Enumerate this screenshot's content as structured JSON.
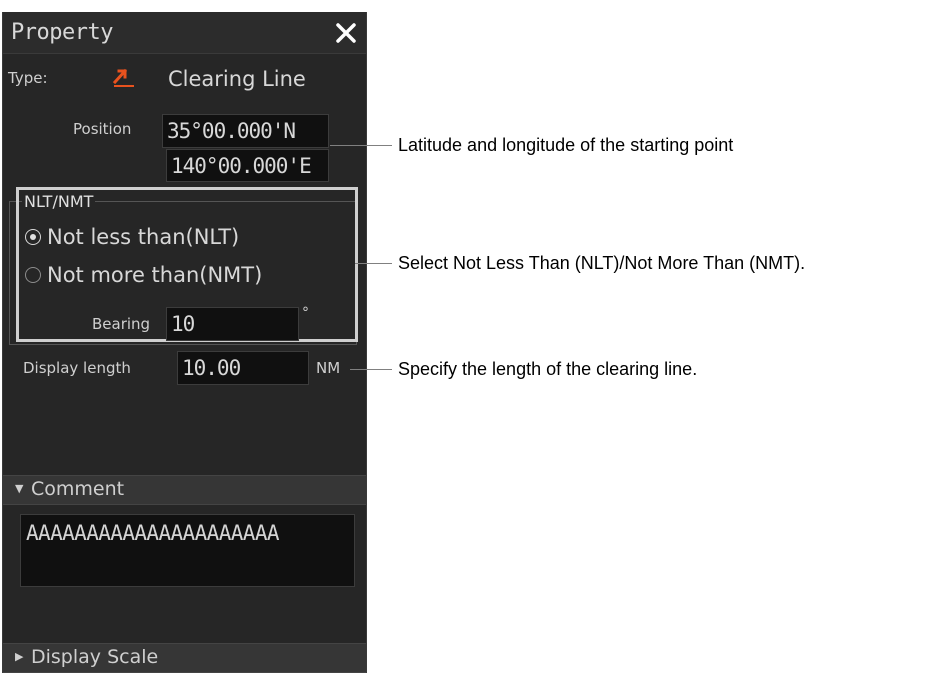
{
  "panel": {
    "title": "Property",
    "close_icon": "close-x-icon",
    "type_label": "Type:",
    "type_icon": "clearing-line-icon",
    "type_icon_color": "#e8521e",
    "type_value": "Clearing Line",
    "position_label": "Position",
    "latitude": "35°00.000'N",
    "longitude": "140°00.000'E",
    "nlt_nmt": {
      "legend": "NLT/NMT",
      "options": [
        {
          "label": "Not less than(NLT)",
          "selected": true
        },
        {
          "label": "Not more than(NMT)",
          "selected": false
        }
      ],
      "bearing_label": "Bearing",
      "bearing_value": "10",
      "bearing_unit": "°"
    },
    "display_length_label": "Display length",
    "display_length_value": "10.00",
    "display_length_unit": "NM",
    "comment_section": {
      "label": "Comment",
      "icon": "chevron-down-icon",
      "expanded": true,
      "text": "AAAAAAAAAAAAAAAAAAAAA"
    },
    "display_scale_section": {
      "label": "Display Scale",
      "icon": "chevron-right-icon",
      "expanded": false
    }
  },
  "callouts": {
    "position": "Latitude and longitude of the starting point",
    "nlt_nmt": "Select Not Less Than (NLT)/Not More Than (NMT).",
    "length": "Specify the length of the clearing line."
  }
}
